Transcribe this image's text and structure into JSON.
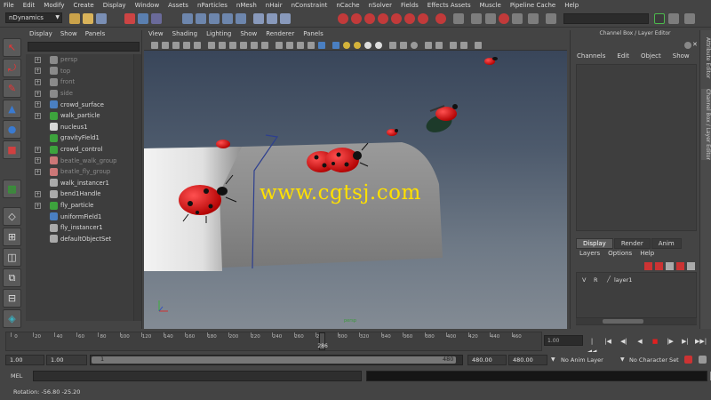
{
  "menubar": [
    "File",
    "Edit",
    "Modify",
    "Create",
    "Display",
    "Window",
    "Assets",
    "nParticles",
    "nMesh",
    "nHair",
    "nConstraint",
    "nCache",
    "nSolver",
    "Fields",
    "Effects Assets",
    "Muscle",
    "Pipeline Cache",
    "Help"
  ],
  "statusline": {
    "mode": "nDynamics"
  },
  "outliner": {
    "menu": [
      "Display",
      "Show",
      "Panels"
    ],
    "items": [
      {
        "label": "persp",
        "expand": true,
        "dim": true,
        "color": "#8a8a8a"
      },
      {
        "label": "top",
        "expand": true,
        "dim": true,
        "color": "#8a8a8a"
      },
      {
        "label": "front",
        "expand": true,
        "dim": true,
        "color": "#8a8a8a"
      },
      {
        "label": "side",
        "expand": true,
        "dim": true,
        "color": "#8a8a8a"
      },
      {
        "label": "crowd_surface",
        "expand": true,
        "dim": false,
        "color": "#4a7fc1"
      },
      {
        "label": "walk_particle",
        "expand": true,
        "dim": false,
        "color": "#3da33d"
      },
      {
        "label": "nucleus1",
        "expand": false,
        "dim": false,
        "color": "#d8d8d8"
      },
      {
        "label": "gravityField1",
        "expand": false,
        "dim": false,
        "color": "#3da33d"
      },
      {
        "label": "crowd_control",
        "expand": true,
        "dim": false,
        "color": "#3da33d"
      },
      {
        "label": "beatle_walk_group",
        "expand": true,
        "dim": true,
        "color": "#cc7777"
      },
      {
        "label": "beatle_fly_group",
        "expand": true,
        "dim": true,
        "color": "#cc7777"
      },
      {
        "label": "walk_instancer1",
        "expand": false,
        "dim": false,
        "color": "#aaaaaa"
      },
      {
        "label": "bend1Handle",
        "expand": true,
        "dim": false,
        "color": "#aaaaaa"
      },
      {
        "label": "fly_particle",
        "expand": true,
        "dim": false,
        "color": "#3da33d"
      },
      {
        "label": "uniformField1",
        "expand": false,
        "dim": false,
        "color": "#4a7fc1"
      },
      {
        "label": "fly_instancer1",
        "expand": false,
        "dim": false,
        "color": "#aaaaaa"
      },
      {
        "label": "defaultObjectSet",
        "expand": false,
        "dim": false,
        "color": "#aaaaaa"
      }
    ]
  },
  "viewport": {
    "menu": [
      "View",
      "Shading",
      "Lighting",
      "Show",
      "Renderer",
      "Panels"
    ],
    "watermark": "www.cgtsj.com",
    "camera_label": "persp"
  },
  "channelbox": {
    "title": "Channel Box / Layer Editor",
    "menu": [
      "Channels",
      "Edit",
      "Object",
      "Show"
    ],
    "layer_tabs": [
      "Display",
      "Render",
      "Anim"
    ],
    "layer_menu": [
      "Layers",
      "Options",
      "Help"
    ],
    "layer": {
      "v": "V",
      "r": "R",
      "name": "layer1"
    },
    "side_tabs": [
      "Attribute Editor",
      "Channel Box / Layer Editor"
    ]
  },
  "timeslider": {
    "ticks": [
      "0",
      "20",
      "40",
      "60",
      "80",
      "100",
      "120",
      "140",
      "160",
      "180",
      "200",
      "220",
      "240",
      "260",
      "280",
      "300",
      "320",
      "340",
      "360",
      "380",
      "400",
      "420",
      "440",
      "460"
    ],
    "current": "286",
    "field": "1.00"
  },
  "rangeslider": {
    "start": "1.00",
    "anim_start": "1.00",
    "range_start": "1",
    "range_end": "480",
    "anim_end": "480.00",
    "end": "480.00",
    "anim_layer": "No Anim Layer",
    "character_set": "No Character Set"
  },
  "cmdline": {
    "label": "MEL"
  },
  "helpline": {
    "text": "Rotation:  -56.80   -25.20"
  }
}
